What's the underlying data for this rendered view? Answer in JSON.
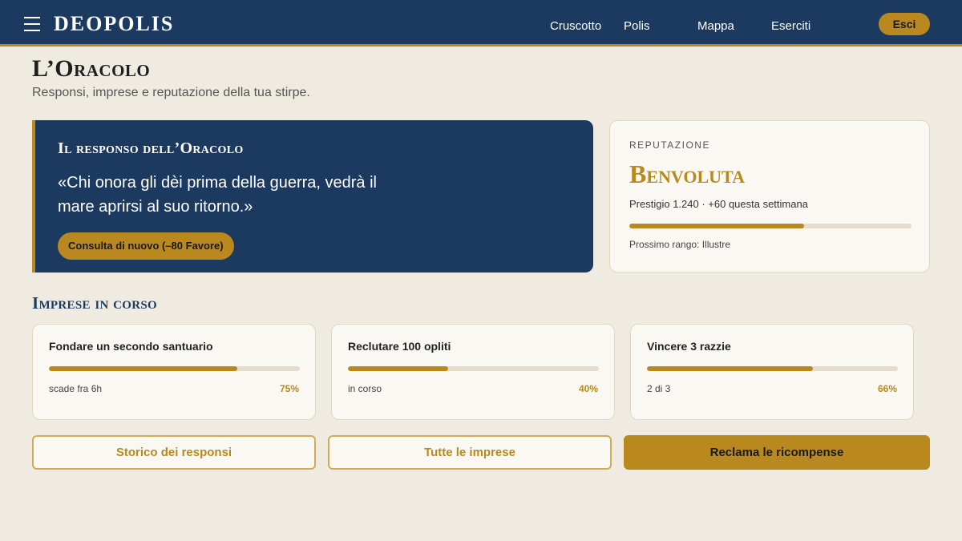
{
  "header": {
    "brand": "DEOPOLIS",
    "nav": [
      "Cruscotto",
      "Polis",
      "Mappa",
      "Eserciti"
    ],
    "logout_label": "Esci"
  },
  "page": {
    "title": "L’Oracolo",
    "subtitle": "Responsi, imprese e reputazione della tua stirpe."
  },
  "oracle": {
    "heading": "Il responso dell’Oracolo",
    "quote": "«Chi onora gli dèi prima della guerra, vedrà il mare aprirsi al suo ritorno.»",
    "consult_label": "Consulta di nuovo (–80 Favore)"
  },
  "reputation": {
    "label": "REPUTAZIONE",
    "value": "Benvoluta",
    "prestige": "Prestigio 1.240 · +60 questa settimana",
    "progress": 0.62,
    "next_rank": "Prossimo rango: Illustre"
  },
  "quests": {
    "title": "Imprese in corso",
    "items": [
      {
        "title": "Fondare un secondo santuario",
        "status": "scade fra 6h",
        "percent": "75%",
        "progress": 0.75
      },
      {
        "title": "Reclutare 100 opliti",
        "status": "in corso",
        "percent": "40%",
        "progress": 0.4
      },
      {
        "title": "Vincere 3 razzie",
        "status": "2 di 3",
        "percent": "66%",
        "progress": 0.66
      }
    ]
  },
  "actions": {
    "history_label": "Storico dei responsi",
    "all_quests_label": "Tutte le imprese",
    "claim_label": "Reclama le ricompense"
  },
  "colors": {
    "navy": "#1c3a5f",
    "gold": "#b9891f",
    "background": "#f0ebe1"
  }
}
